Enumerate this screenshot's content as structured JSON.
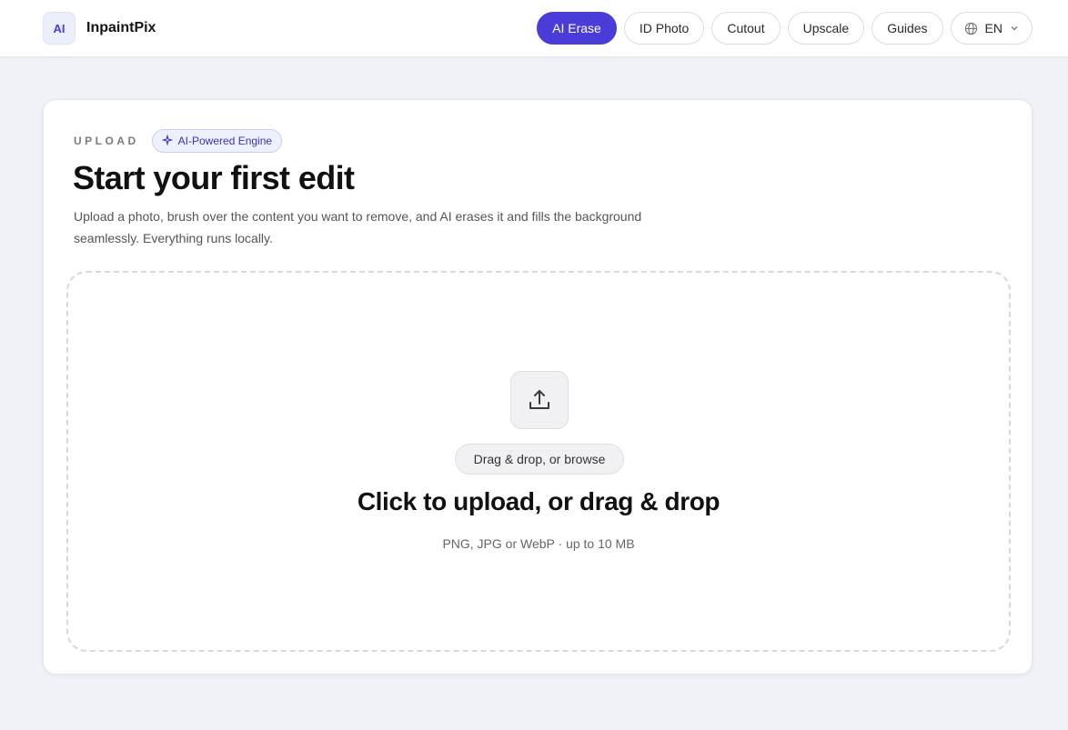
{
  "header": {
    "logo_text": "AI",
    "brand_name": "InpaintPix",
    "nav": [
      {
        "label": "AI Erase",
        "active": true
      },
      {
        "label": "ID Photo",
        "active": false
      },
      {
        "label": "Cutout",
        "active": false
      },
      {
        "label": "Upscale",
        "active": false
      },
      {
        "label": "Guides",
        "active": false
      }
    ],
    "language": "EN"
  },
  "upload": {
    "eyebrow": "UPLOAD",
    "badge": "AI-Powered Engine",
    "title": "Start your first edit",
    "description": "Upload a photo, brush over the content you want to remove, and AI erases it and fills the background seamlessly. Everything runs locally.",
    "dropzone": {
      "browse_label": "Drag & drop, or browse",
      "title": "Click to upload, or drag & drop",
      "subtitle": "PNG, JPG or WebP · up to 10 MB"
    }
  },
  "icons": {
    "badge_icon": "sparkle-icon",
    "upload_icon": "upload-icon",
    "language_icon": "globe-icon",
    "language_chevron": "chevron-down-icon"
  },
  "colors": {
    "accent": "#4a3cd9",
    "page_background": "#f0f2f7",
    "badge_background": "#eef0fd"
  }
}
